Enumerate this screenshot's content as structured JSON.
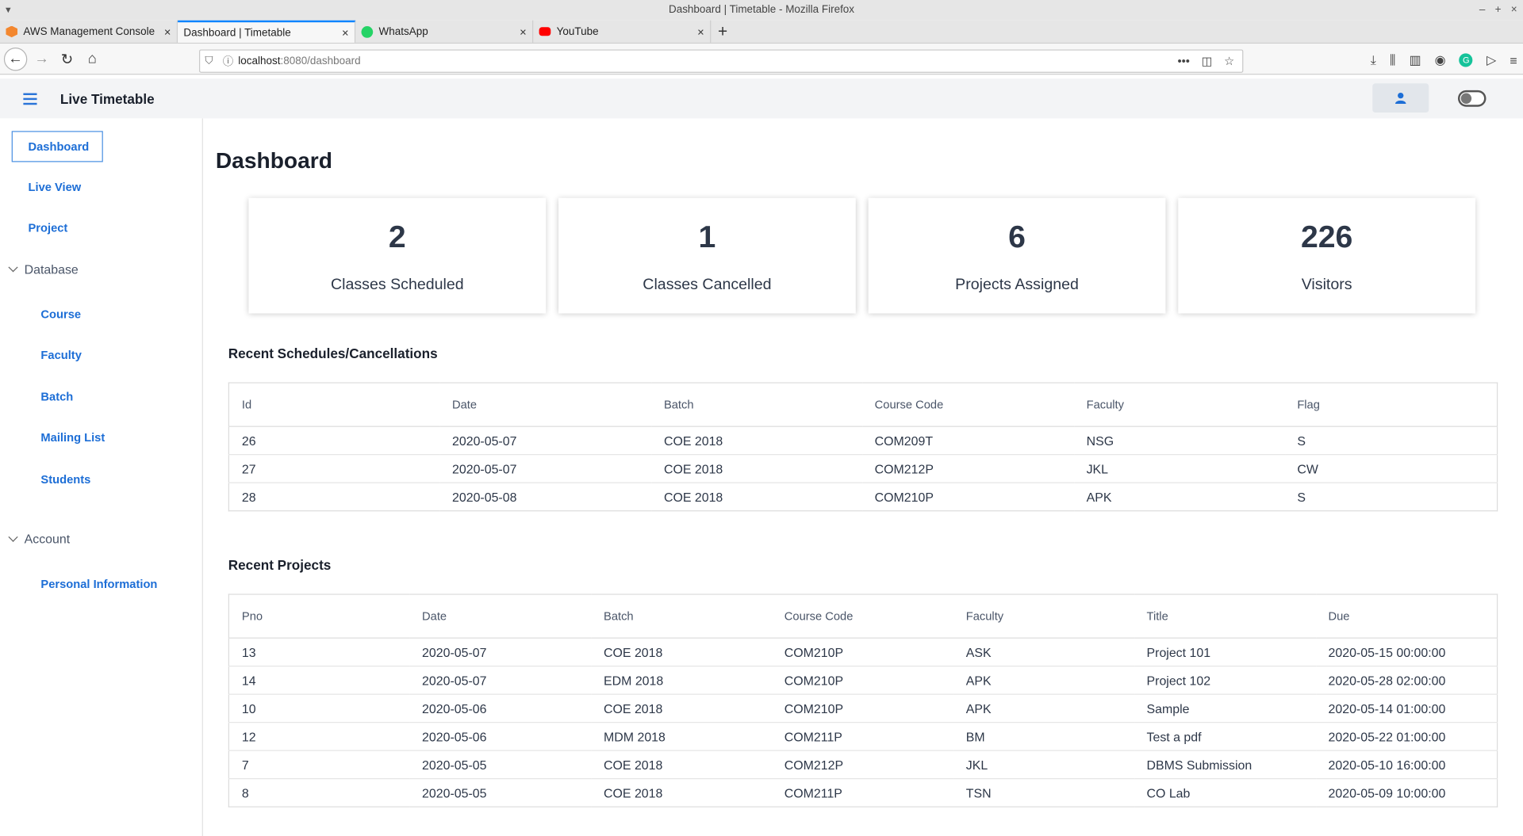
{
  "browser": {
    "window_title": "Dashboard | Timetable - Mozilla Firefox",
    "tabs": [
      {
        "title": "AWS Management Console",
        "icon": "aws-icon"
      },
      {
        "title": "Dashboard | Timetable",
        "icon": "page-icon"
      },
      {
        "title": "WhatsApp",
        "icon": "whatsapp-icon"
      },
      {
        "title": "YouTube",
        "icon": "youtube-icon"
      }
    ],
    "url_host": "localhost",
    "url_path": ":8080/dashboard"
  },
  "header": {
    "brand": "Live Timetable"
  },
  "sidebar": {
    "items": {
      "dashboard": "Dashboard",
      "live_view": "Live View",
      "project": "Project",
      "database": "Database",
      "course": "Course",
      "faculty": "Faculty",
      "batch": "Batch",
      "mailing_list": "Mailing List",
      "students": "Students",
      "account": "Account",
      "personal_information": "Personal Information"
    }
  },
  "main": {
    "title": "Dashboard",
    "stats": [
      {
        "value": "2",
        "label": "Classes Scheduled"
      },
      {
        "value": "1",
        "label": "Classes Cancelled"
      },
      {
        "value": "6",
        "label": "Projects Assigned"
      },
      {
        "value": "226",
        "label": "Visitors"
      }
    ],
    "schedules": {
      "title": "Recent Schedules/Cancellations",
      "columns": [
        "Id",
        "Date",
        "Batch",
        "Course Code",
        "Faculty",
        "Flag"
      ],
      "rows": [
        [
          "26",
          "2020-05-07",
          "COE 2018",
          "COM209T",
          "NSG",
          "S"
        ],
        [
          "27",
          "2020-05-07",
          "COE 2018",
          "COM212P",
          "JKL",
          "CW"
        ],
        [
          "28",
          "2020-05-08",
          "COE 2018",
          "COM210P",
          "APK",
          "S"
        ]
      ]
    },
    "projects": {
      "title": "Recent Projects",
      "columns": [
        "Pno",
        "Date",
        "Batch",
        "Course Code",
        "Faculty",
        "Title",
        "Due"
      ],
      "rows": [
        [
          "13",
          "2020-05-07",
          "COE 2018",
          "COM210P",
          "ASK",
          "Project 101",
          "2020-05-15 00:00:00"
        ],
        [
          "14",
          "2020-05-07",
          "EDM 2018",
          "COM210P",
          "APK",
          "Project 102",
          "2020-05-28 02:00:00"
        ],
        [
          "10",
          "2020-05-06",
          "COE 2018",
          "COM210P",
          "APK",
          "Sample",
          "2020-05-14 01:00:00"
        ],
        [
          "12",
          "2020-05-06",
          "MDM 2018",
          "COM211P",
          "BM",
          "Test a pdf",
          "2020-05-22 01:00:00"
        ],
        [
          "7",
          "2020-05-05",
          "COE 2018",
          "COM212P",
          "JKL",
          "DBMS Submission",
          "2020-05-10 16:00:00"
        ],
        [
          "8",
          "2020-05-05",
          "COE 2018",
          "COM211P",
          "TSN",
          "CO Lab",
          "2020-05-09 10:00:00"
        ]
      ]
    }
  },
  "colors": {
    "accent": "#1d6ed6",
    "header_bg": "#f3f4f6",
    "text_dark": "#1a202c"
  }
}
